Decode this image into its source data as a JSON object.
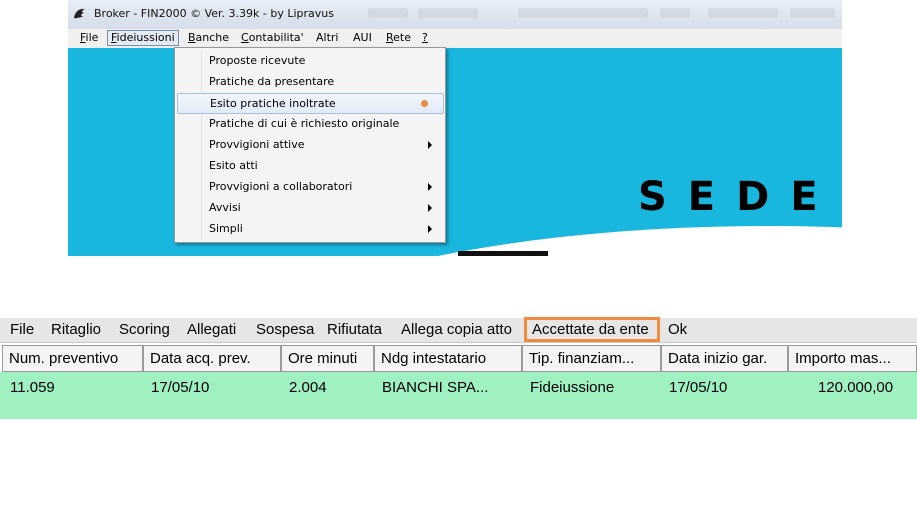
{
  "window": {
    "title": "Broker - FIN2000 © Ver.  3.39k - by Lipravus",
    "menu": [
      {
        "prefix": "",
        "mnemonic": "F",
        "rest": "ile"
      },
      {
        "prefix": "",
        "mnemonic": "F",
        "rest": "ideiussioni"
      },
      {
        "prefix": "",
        "mnemonic": "B",
        "rest": "anche"
      },
      {
        "prefix": "",
        "mnemonic": "C",
        "rest": "ontabilita'"
      },
      {
        "prefix": "Altri",
        "mnemonic": "",
        "rest": ""
      },
      {
        "prefix": "AUI",
        "mnemonic": "",
        "rest": ""
      },
      {
        "prefix": "",
        "mnemonic": "R",
        "rest": "ete"
      },
      {
        "prefix": "",
        "mnemonic": "?",
        "rest": ""
      }
    ],
    "dropdown": [
      {
        "label": "Proposte ricevute"
      },
      {
        "label": "Pratiche da presentare"
      },
      {
        "label": "Esito pratiche inoltrate"
      },
      {
        "label": "Pratiche di cui è richiesto originale"
      },
      {
        "label": "Provvigioni attive"
      },
      {
        "label": "Esito atti"
      },
      {
        "label": "Provvigioni a collaboratori"
      },
      {
        "label": "Avvisi"
      },
      {
        "label": "Simpli"
      }
    ],
    "desktop_text": "SEDE",
    "accent_color": "#f08a3c",
    "desktop_color": "#19b6de"
  },
  "panel": {
    "menu": [
      "File",
      "Ritaglio",
      "Scoring",
      "Allegati",
      "Sospesa",
      "Rifiutata",
      "Allega copia atto",
      "Accettate da ente",
      "Ok"
    ],
    "highlighted_menu": "Accettate da ente",
    "columns": [
      "Num. preventivo",
      "Data acq. prev.",
      "Ore minuti",
      "Ndg intestatario",
      "Tip. finanziam...",
      "Data inizio gar.",
      "Importo mas..."
    ],
    "rows": [
      [
        "11.059",
        "17/05/10",
        "2.004",
        "BIANCHI SPA...",
        "Fideiussione",
        "17/05/10",
        "120.000,00"
      ]
    ],
    "row_color": "#9ff1c1"
  }
}
